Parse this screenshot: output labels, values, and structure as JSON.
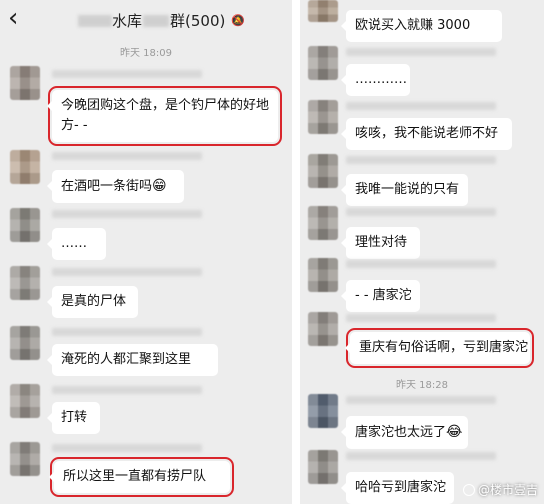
{
  "header": {
    "back_icon": "chevron-left-icon",
    "title": "水库",
    "title_suffix": "群(500)",
    "mute_icon": "bell-off-icon"
  },
  "left_timestamp": "昨天 18:09",
  "right_timestamp": "昨天 18:28",
  "left_messages": [
    {
      "text": "今晚团购这个盘，是个钓尸体的好地方- -",
      "highlighted": true
    },
    {
      "text": "在酒吧一条街吗",
      "emoji": "😁"
    },
    {
      "text": "……"
    },
    {
      "text": "是真的尸体"
    },
    {
      "text": "淹死的人都汇聚到这里"
    },
    {
      "text": "打转"
    },
    {
      "text": "所以这里一直都有捞尸队",
      "highlighted": true
    }
  ],
  "right_messages": [
    {
      "text": "欧说买入就赚 3000"
    },
    {
      "text": "…………"
    },
    {
      "text": "咳咳，我不能说老师不好"
    },
    {
      "text": "我唯一能说的只有"
    },
    {
      "text": "理性对待"
    },
    {
      "text": "- - 唐家沱"
    },
    {
      "text": "重庆有句俗话啊，亏到唐家沱",
      "highlighted": true
    },
    {
      "text": "唐家沱也太远了",
      "emoji": "😂"
    },
    {
      "text": "哈哈亏到唐家沱"
    }
  ],
  "watermark": "@楼市壹吉",
  "colors": {
    "chat_bg": "#ededed",
    "bubble": "#ffffff",
    "highlight": "#d9262c"
  }
}
